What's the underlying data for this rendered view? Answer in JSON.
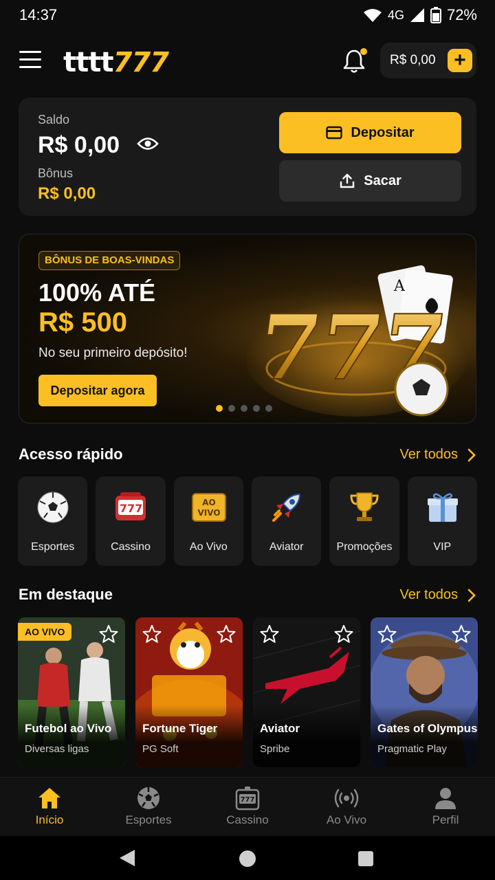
{
  "status": {
    "time": "14:37",
    "network": "4G",
    "battery": "72%"
  },
  "header": {
    "logo_part1": "tttt",
    "logo_part2": "777",
    "balance": "R$ 0,00",
    "add_label": "+"
  },
  "wallet": {
    "saldo_label": "Saldo",
    "saldo_value": "R$ 0,00",
    "bonus_label": "Bônus",
    "bonus_value": "R$ 0,00",
    "deposit_label": "Depositar",
    "withdraw_label": "Sacar"
  },
  "banner": {
    "tag": "BÔNUS DE BOAS-VINDAS",
    "title_line1": "100% ATÉ",
    "title_line2": "R$ 500",
    "subtitle": "No seu primeiro depósito!",
    "cta": "Depositar agora",
    "active_slide": 1,
    "slides_count": 5
  },
  "quick_access": {
    "title": "Acesso rápido",
    "see_all": "Ver todos",
    "items": [
      {
        "label": "Esportes",
        "icon": "soccer-ball-icon"
      },
      {
        "label": "Cassino",
        "icon": "slot-machine-icon"
      },
      {
        "label": "Ao Vivo",
        "icon": "live-badge-icon",
        "icon_text": "AO\nVIVO"
      },
      {
        "label": "Aviator",
        "icon": "rocket-icon"
      },
      {
        "label": "Promoções",
        "icon": "trophy-icon"
      },
      {
        "label": "VIP",
        "icon": "gift-icon"
      }
    ]
  },
  "featured": {
    "title": "Em destaque",
    "see_all": "Ver todos",
    "live_badge": "AO VIVO",
    "cards": [
      {
        "name": "Futebol ao Vivo",
        "provider": "Diversas ligas"
      },
      {
        "name": "Fortune Tiger",
        "provider": "PG Soft"
      },
      {
        "name": "Aviator",
        "provider": "Spribe"
      },
      {
        "name": "Gates of Olympus",
        "provider": "Pragmatic Play"
      }
    ]
  },
  "bottom_nav": {
    "items": [
      {
        "label": "Início",
        "icon": "home-icon",
        "active": true
      },
      {
        "label": "Esportes",
        "icon": "soccer-ball-icon",
        "active": false
      },
      {
        "label": "Cassino",
        "icon": "slot-machine-icon",
        "active": false
      },
      {
        "label": "Ao Vivo",
        "icon": "broadcast-icon",
        "active": false
      },
      {
        "label": "Perfil",
        "icon": "user-icon",
        "active": false
      }
    ]
  },
  "colors": {
    "accent": "#fbbf24",
    "background": "#0d0d0d",
    "card": "#1c1c1c"
  }
}
